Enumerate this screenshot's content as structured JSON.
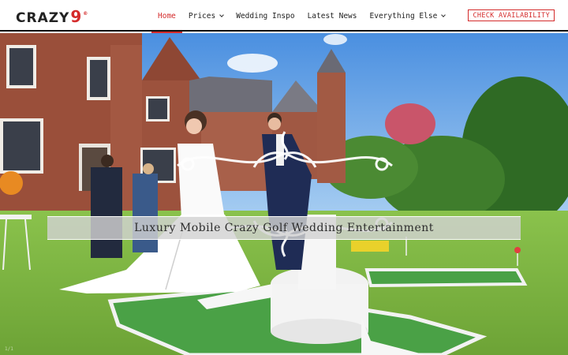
{
  "header": {
    "logo_text": "CRAZY",
    "logo_number": "9",
    "logo_mark": "®",
    "nav": [
      {
        "label": "Home",
        "active": true,
        "dropdown": false
      },
      {
        "label": "Prices",
        "active": false,
        "dropdown": true
      },
      {
        "label": "Wedding Inspo",
        "active": false,
        "dropdown": false
      },
      {
        "label": "Latest News",
        "active": false,
        "dropdown": false
      },
      {
        "label": "Everything Else",
        "active": false,
        "dropdown": true
      }
    ],
    "cta_label": "CHECK AVAILABILITY"
  },
  "hero": {
    "title": "Luxury Mobile Crazy Golf Wedding Entertainment",
    "corner_mark": "1/1"
  },
  "colors": {
    "accent": "#d42b2b",
    "header_bg": "#ffffff",
    "text": "#222222",
    "banner_bg": "#d2d2d2"
  },
  "icons": {
    "dropdown": "chevron-down-icon"
  }
}
